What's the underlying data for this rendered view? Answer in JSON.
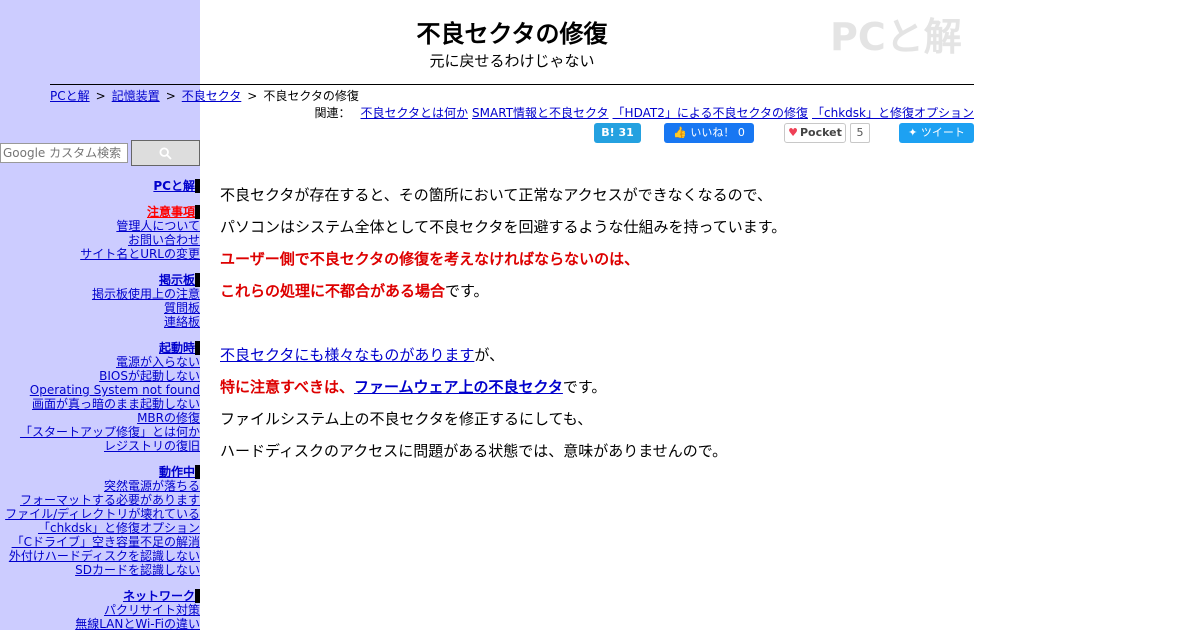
{
  "header": {
    "title": "不良セクタの修復",
    "subtitle": "元に戻せるわけじゃない",
    "logo": "PCと解"
  },
  "breadcrumb": {
    "items": [
      "PCと解",
      "記憶装置",
      "不良セクタ"
    ],
    "current": "不良セクタの修復",
    "separator": ">"
  },
  "related": {
    "label": "関連：",
    "links": [
      "不良セクタとは何か",
      "SMART情報と不良セクタ",
      "「HDAT2」による不良セクタの修復",
      "「chkdsk」と修復オプション"
    ]
  },
  "social": {
    "hatena_label": "B!",
    "hatena_count": "31",
    "like_label": "いいね！",
    "like_count": "0",
    "pocket_label": "Pocket",
    "pocket_count": "5",
    "tweet_label": "ツイート"
  },
  "search": {
    "placeholder": "Google カスタム検索"
  },
  "nav": {
    "home": "PCと解",
    "groups": [
      {
        "title": "注意事項",
        "warn": true,
        "items": [
          "管理人について",
          "お問い合わせ",
          "サイト名とURLの変更"
        ]
      },
      {
        "title": "掲示板",
        "items": [
          "掲示板使用上の注意",
          "質問板",
          "連絡板"
        ]
      },
      {
        "title": "起動時",
        "items": [
          "電源が入らない",
          "BIOSが起動しない",
          "Operating System not found",
          "画面が真っ暗のまま起動しない",
          "MBRの修復",
          "「スタートアップ修復」とは何か",
          "レジストリの復旧"
        ]
      },
      {
        "title": "動作中",
        "items": [
          "突然電源が落ちる",
          "フォーマットする必要があります",
          "ファイル/ディレクトリが壊れている",
          "「chkdsk」と修復オプション",
          "「Cドライブ」空き容量不足の解消",
          "外付けハードディスクを認識しない",
          "SDカードを認識しない"
        ]
      },
      {
        "title": "ネットワーク",
        "items": [
          "パクリサイト対策",
          "無線LANとWi-Fiの違い"
        ]
      }
    ]
  },
  "content": {
    "p1": "不良セクタが存在すると、その箇所において正常なアクセスができなくなるので、",
    "p2": "パソコンはシステム全体として不良セクタを回避するような仕組みを持っています。",
    "p3": "ユーザー側で不良セクタの修復を考えなければならないのは、",
    "p4_red": "これらの処理に不都合がある場合",
    "p4_rest": "です。",
    "p5_link": "不良セクタにも様々なものがあります",
    "p5_rest": "が、",
    "p6_red": "特に注意すべきは、",
    "p6_link": "ファームウェア上の不良セクタ",
    "p6_rest": "です。",
    "p7": "ファイルシステム上の不良セクタを修正するにしても、",
    "p8": "ハードディスクのアクセスに問題がある状態では、意味がありませんので。"
  }
}
